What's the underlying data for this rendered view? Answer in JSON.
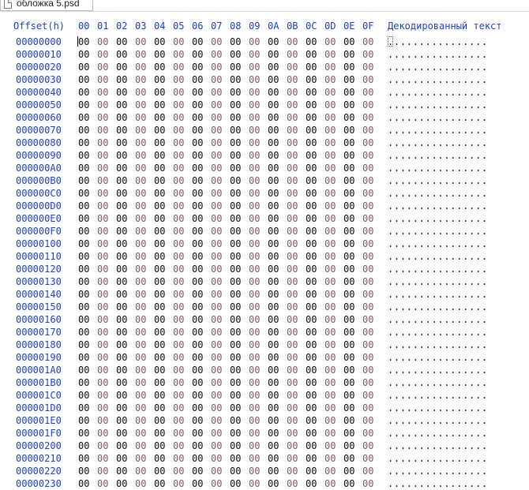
{
  "tab": {
    "title": "обложка 5.psd",
    "icon": "file-icon"
  },
  "header": {
    "offset_label": "Offset(h)",
    "columns": [
      "00",
      "01",
      "02",
      "03",
      "04",
      "05",
      "06",
      "07",
      "08",
      "09",
      "0A",
      "0B",
      "0C",
      "0D",
      "0E",
      "0F"
    ],
    "decoded_label": "Декодированный текст"
  },
  "rows": [
    {
      "offset": "00000000",
      "bytes": [
        "00",
        "00",
        "00",
        "00",
        "00",
        "00",
        "00",
        "00",
        "00",
        "00",
        "00",
        "00",
        "00",
        "00",
        "00",
        "00"
      ],
      "decoded": "................"
    },
    {
      "offset": "00000010",
      "bytes": [
        "00",
        "00",
        "00",
        "00",
        "00",
        "00",
        "00",
        "00",
        "00",
        "00",
        "00",
        "00",
        "00",
        "00",
        "00",
        "00"
      ],
      "decoded": "................"
    },
    {
      "offset": "00000020",
      "bytes": [
        "00",
        "00",
        "00",
        "00",
        "00",
        "00",
        "00",
        "00",
        "00",
        "00",
        "00",
        "00",
        "00",
        "00",
        "00",
        "00"
      ],
      "decoded": "................"
    },
    {
      "offset": "00000030",
      "bytes": [
        "00",
        "00",
        "00",
        "00",
        "00",
        "00",
        "00",
        "00",
        "00",
        "00",
        "00",
        "00",
        "00",
        "00",
        "00",
        "00"
      ],
      "decoded": "................"
    },
    {
      "offset": "00000040",
      "bytes": [
        "00",
        "00",
        "00",
        "00",
        "00",
        "00",
        "00",
        "00",
        "00",
        "00",
        "00",
        "00",
        "00",
        "00",
        "00",
        "00"
      ],
      "decoded": "................"
    },
    {
      "offset": "00000050",
      "bytes": [
        "00",
        "00",
        "00",
        "00",
        "00",
        "00",
        "00",
        "00",
        "00",
        "00",
        "00",
        "00",
        "00",
        "00",
        "00",
        "00"
      ],
      "decoded": "................"
    },
    {
      "offset": "00000060",
      "bytes": [
        "00",
        "00",
        "00",
        "00",
        "00",
        "00",
        "00",
        "00",
        "00",
        "00",
        "00",
        "00",
        "00",
        "00",
        "00",
        "00"
      ],
      "decoded": "................"
    },
    {
      "offset": "00000070",
      "bytes": [
        "00",
        "00",
        "00",
        "00",
        "00",
        "00",
        "00",
        "00",
        "00",
        "00",
        "00",
        "00",
        "00",
        "00",
        "00",
        "00"
      ],
      "decoded": "................"
    },
    {
      "offset": "00000080",
      "bytes": [
        "00",
        "00",
        "00",
        "00",
        "00",
        "00",
        "00",
        "00",
        "00",
        "00",
        "00",
        "00",
        "00",
        "00",
        "00",
        "00"
      ],
      "decoded": "................"
    },
    {
      "offset": "00000090",
      "bytes": [
        "00",
        "00",
        "00",
        "00",
        "00",
        "00",
        "00",
        "00",
        "00",
        "00",
        "00",
        "00",
        "00",
        "00",
        "00",
        "00"
      ],
      "decoded": "................"
    },
    {
      "offset": "000000A0",
      "bytes": [
        "00",
        "00",
        "00",
        "00",
        "00",
        "00",
        "00",
        "00",
        "00",
        "00",
        "00",
        "00",
        "00",
        "00",
        "00",
        "00"
      ],
      "decoded": "................"
    },
    {
      "offset": "000000B0",
      "bytes": [
        "00",
        "00",
        "00",
        "00",
        "00",
        "00",
        "00",
        "00",
        "00",
        "00",
        "00",
        "00",
        "00",
        "00",
        "00",
        "00"
      ],
      "decoded": "................"
    },
    {
      "offset": "000000C0",
      "bytes": [
        "00",
        "00",
        "00",
        "00",
        "00",
        "00",
        "00",
        "00",
        "00",
        "00",
        "00",
        "00",
        "00",
        "00",
        "00",
        "00"
      ],
      "decoded": "................"
    },
    {
      "offset": "000000D0",
      "bytes": [
        "00",
        "00",
        "00",
        "00",
        "00",
        "00",
        "00",
        "00",
        "00",
        "00",
        "00",
        "00",
        "00",
        "00",
        "00",
        "00"
      ],
      "decoded": "................"
    },
    {
      "offset": "000000E0",
      "bytes": [
        "00",
        "00",
        "00",
        "00",
        "00",
        "00",
        "00",
        "00",
        "00",
        "00",
        "00",
        "00",
        "00",
        "00",
        "00",
        "00"
      ],
      "decoded": "................"
    },
    {
      "offset": "000000F0",
      "bytes": [
        "00",
        "00",
        "00",
        "00",
        "00",
        "00",
        "00",
        "00",
        "00",
        "00",
        "00",
        "00",
        "00",
        "00",
        "00",
        "00"
      ],
      "decoded": "................"
    },
    {
      "offset": "00000100",
      "bytes": [
        "00",
        "00",
        "00",
        "00",
        "00",
        "00",
        "00",
        "00",
        "00",
        "00",
        "00",
        "00",
        "00",
        "00",
        "00",
        "00"
      ],
      "decoded": "................"
    },
    {
      "offset": "00000110",
      "bytes": [
        "00",
        "00",
        "00",
        "00",
        "00",
        "00",
        "00",
        "00",
        "00",
        "00",
        "00",
        "00",
        "00",
        "00",
        "00",
        "00"
      ],
      "decoded": "................"
    },
    {
      "offset": "00000120",
      "bytes": [
        "00",
        "00",
        "00",
        "00",
        "00",
        "00",
        "00",
        "00",
        "00",
        "00",
        "00",
        "00",
        "00",
        "00",
        "00",
        "00"
      ],
      "decoded": "................"
    },
    {
      "offset": "00000130",
      "bytes": [
        "00",
        "00",
        "00",
        "00",
        "00",
        "00",
        "00",
        "00",
        "00",
        "00",
        "00",
        "00",
        "00",
        "00",
        "00",
        "00"
      ],
      "decoded": "................"
    },
    {
      "offset": "00000140",
      "bytes": [
        "00",
        "00",
        "00",
        "00",
        "00",
        "00",
        "00",
        "00",
        "00",
        "00",
        "00",
        "00",
        "00",
        "00",
        "00",
        "00"
      ],
      "decoded": "................"
    },
    {
      "offset": "00000150",
      "bytes": [
        "00",
        "00",
        "00",
        "00",
        "00",
        "00",
        "00",
        "00",
        "00",
        "00",
        "00",
        "00",
        "00",
        "00",
        "00",
        "00"
      ],
      "decoded": "................"
    },
    {
      "offset": "00000160",
      "bytes": [
        "00",
        "00",
        "00",
        "00",
        "00",
        "00",
        "00",
        "00",
        "00",
        "00",
        "00",
        "00",
        "00",
        "00",
        "00",
        "00"
      ],
      "decoded": "................"
    },
    {
      "offset": "00000170",
      "bytes": [
        "00",
        "00",
        "00",
        "00",
        "00",
        "00",
        "00",
        "00",
        "00",
        "00",
        "00",
        "00",
        "00",
        "00",
        "00",
        "00"
      ],
      "decoded": "................"
    },
    {
      "offset": "00000180",
      "bytes": [
        "00",
        "00",
        "00",
        "00",
        "00",
        "00",
        "00",
        "00",
        "00",
        "00",
        "00",
        "00",
        "00",
        "00",
        "00",
        "00"
      ],
      "decoded": "................"
    },
    {
      "offset": "00000190",
      "bytes": [
        "00",
        "00",
        "00",
        "00",
        "00",
        "00",
        "00",
        "00",
        "00",
        "00",
        "00",
        "00",
        "00",
        "00",
        "00",
        "00"
      ],
      "decoded": "................"
    },
    {
      "offset": "000001A0",
      "bytes": [
        "00",
        "00",
        "00",
        "00",
        "00",
        "00",
        "00",
        "00",
        "00",
        "00",
        "00",
        "00",
        "00",
        "00",
        "00",
        "00"
      ],
      "decoded": "................"
    },
    {
      "offset": "000001B0",
      "bytes": [
        "00",
        "00",
        "00",
        "00",
        "00",
        "00",
        "00",
        "00",
        "00",
        "00",
        "00",
        "00",
        "00",
        "00",
        "00",
        "00"
      ],
      "decoded": "................"
    },
    {
      "offset": "000001C0",
      "bytes": [
        "00",
        "00",
        "00",
        "00",
        "00",
        "00",
        "00",
        "00",
        "00",
        "00",
        "00",
        "00",
        "00",
        "00",
        "00",
        "00"
      ],
      "decoded": "................"
    },
    {
      "offset": "000001D0",
      "bytes": [
        "00",
        "00",
        "00",
        "00",
        "00",
        "00",
        "00",
        "00",
        "00",
        "00",
        "00",
        "00",
        "00",
        "00",
        "00",
        "00"
      ],
      "decoded": "................"
    },
    {
      "offset": "000001E0",
      "bytes": [
        "00",
        "00",
        "00",
        "00",
        "00",
        "00",
        "00",
        "00",
        "00",
        "00",
        "00",
        "00",
        "00",
        "00",
        "00",
        "00"
      ],
      "decoded": "................"
    },
    {
      "offset": "000001F0",
      "bytes": [
        "00",
        "00",
        "00",
        "00",
        "00",
        "00",
        "00",
        "00",
        "00",
        "00",
        "00",
        "00",
        "00",
        "00",
        "00",
        "00"
      ],
      "decoded": "................"
    },
    {
      "offset": "00000200",
      "bytes": [
        "00",
        "00",
        "00",
        "00",
        "00",
        "00",
        "00",
        "00",
        "00",
        "00",
        "00",
        "00",
        "00",
        "00",
        "00",
        "00"
      ],
      "decoded": "................"
    },
    {
      "offset": "00000210",
      "bytes": [
        "00",
        "00",
        "00",
        "00",
        "00",
        "00",
        "00",
        "00",
        "00",
        "00",
        "00",
        "00",
        "00",
        "00",
        "00",
        "00"
      ],
      "decoded": "................"
    },
    {
      "offset": "00000220",
      "bytes": [
        "00",
        "00",
        "00",
        "00",
        "00",
        "00",
        "00",
        "00",
        "00",
        "00",
        "00",
        "00",
        "00",
        "00",
        "00",
        "00"
      ],
      "decoded": "................"
    },
    {
      "offset": "00000230",
      "bytes": [
        "00",
        "00",
        "00",
        "00",
        "00",
        "00",
        "00",
        "00",
        "00",
        "00",
        "00",
        "00",
        "00",
        "00",
        "00",
        "00"
      ],
      "decoded": "................"
    }
  ],
  "colors": {
    "accent": "#1f3fc8",
    "even_byte": "#111111",
    "odd_byte": "#8a5a5a"
  }
}
